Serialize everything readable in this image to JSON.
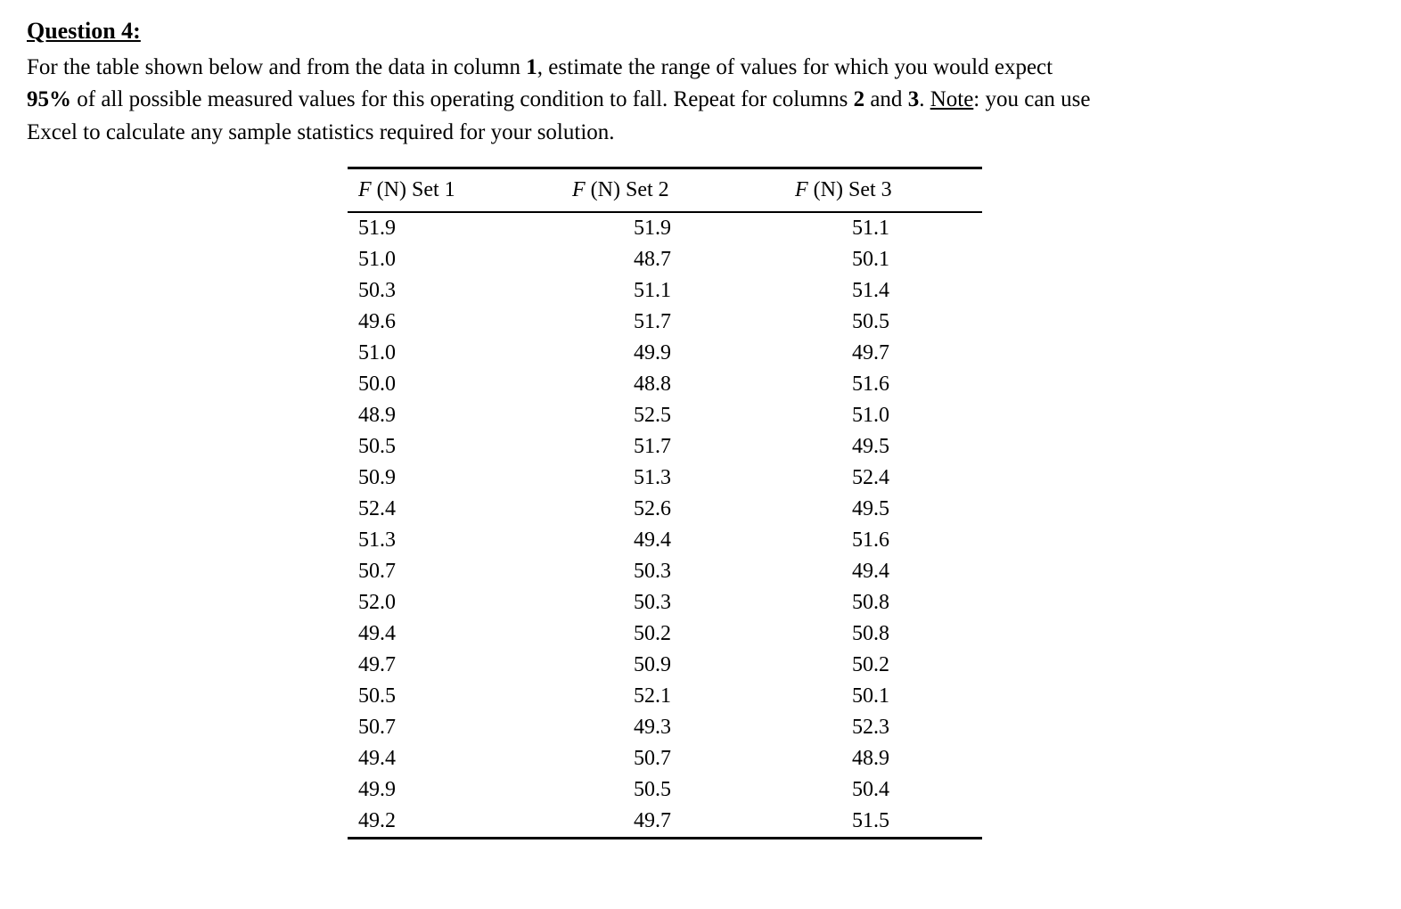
{
  "question": {
    "title": "Question 4:",
    "body_part1": "For the table shown below and from the data in column ",
    "bold1": "1",
    "body_part2": ", estimate the range of values for which you would expect ",
    "bold2": "95%",
    "body_part3": " of all possible measured values for this operating condition to fall. Repeat for columns ",
    "bold3": "2",
    "body_part4": " and ",
    "bold4": "3",
    "body_part5": ". ",
    "note_label": "Note",
    "note_text": ": you can use Excel to calculate any sample statistics required for your solution."
  },
  "chart_data": {
    "type": "table",
    "headers": {
      "col1_f": "F",
      "col1_rest": " (N) Set 1",
      "col2_f": "F",
      "col2_rest": " (N) Set 2",
      "col3_f": "F",
      "col3_rest": " (N) Set 3"
    },
    "rows": [
      {
        "c1": "51.9",
        "c2": "51.9",
        "c3": "51.1"
      },
      {
        "c1": "51.0",
        "c2": "48.7",
        "c3": "50.1"
      },
      {
        "c1": "50.3",
        "c2": "51.1",
        "c3": "51.4"
      },
      {
        "c1": "49.6",
        "c2": "51.7",
        "c3": "50.5"
      },
      {
        "c1": "51.0",
        "c2": "49.9",
        "c3": "49.7"
      },
      {
        "c1": "50.0",
        "c2": "48.8",
        "c3": "51.6"
      },
      {
        "c1": "48.9",
        "c2": "52.5",
        "c3": "51.0"
      },
      {
        "c1": "50.5",
        "c2": "51.7",
        "c3": "49.5"
      },
      {
        "c1": "50.9",
        "c2": "51.3",
        "c3": "52.4"
      },
      {
        "c1": "52.4",
        "c2": "52.6",
        "c3": "49.5"
      },
      {
        "c1": "51.3",
        "c2": "49.4",
        "c3": "51.6"
      },
      {
        "c1": "50.7",
        "c2": "50.3",
        "c3": "49.4"
      },
      {
        "c1": "52.0",
        "c2": "50.3",
        "c3": "50.8"
      },
      {
        "c1": "49.4",
        "c2": "50.2",
        "c3": "50.8"
      },
      {
        "c1": "49.7",
        "c2": "50.9",
        "c3": "50.2"
      },
      {
        "c1": "50.5",
        "c2": "52.1",
        "c3": "50.1"
      },
      {
        "c1": "50.7",
        "c2": "49.3",
        "c3": "52.3"
      },
      {
        "c1": "49.4",
        "c2": "50.7",
        "c3": "48.9"
      },
      {
        "c1": "49.9",
        "c2": "50.5",
        "c3": "50.4"
      },
      {
        "c1": "49.2",
        "c2": "49.7",
        "c3": "51.5"
      }
    ]
  }
}
